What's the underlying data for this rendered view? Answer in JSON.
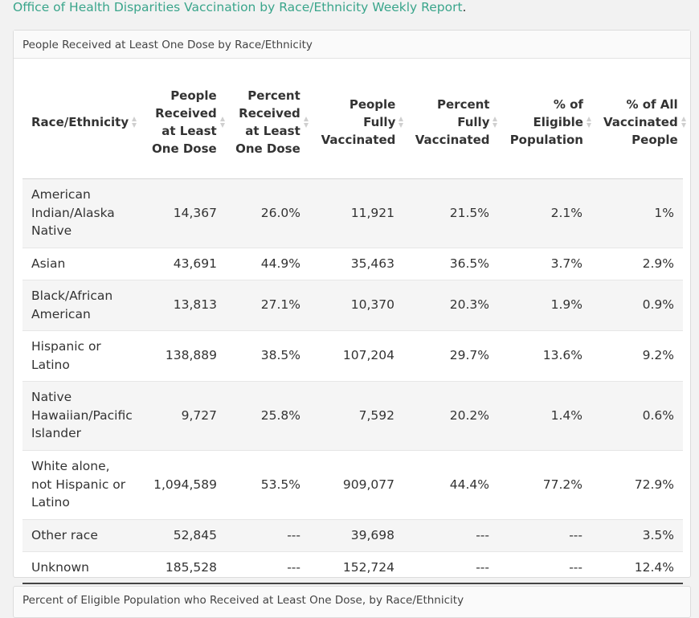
{
  "intro": {
    "link_text": "Office of Health Disparities Vaccination by Race/Ethnicity Weekly Report",
    "trailing": "."
  },
  "panel": {
    "title": "People Received at Least One Dose by Race/Ethnicity"
  },
  "table": {
    "columns": [
      {
        "label": "Race/Ethnicity",
        "sortable": true
      },
      {
        "label": "People Received at Least One Dose",
        "sortable": true
      },
      {
        "label": "Percent Received at Least One Dose",
        "sortable": true
      },
      {
        "label": "People Fully Vaccinated",
        "sortable": true
      },
      {
        "label": "Percent Fully Vaccinated",
        "sortable": true
      },
      {
        "label": "% of Eligible Population",
        "sortable": true
      },
      {
        "label": "% of All Vaccinated People",
        "sortable": true
      }
    ],
    "rows": [
      [
        "American Indian/Alaska Native",
        "14,367",
        "26.0%",
        "11,921",
        "21.5%",
        "2.1%",
        "1%"
      ],
      [
        "Asian",
        "43,691",
        "44.9%",
        "35,463",
        "36.5%",
        "3.7%",
        "2.9%"
      ],
      [
        "Black/African American",
        "13,813",
        "27.1%",
        "10,370",
        "20.3%",
        "1.9%",
        "0.9%"
      ],
      [
        "Hispanic or Latino",
        "138,889",
        "38.5%",
        "107,204",
        "29.7%",
        "13.6%",
        "9.2%"
      ],
      [
        "Native Hawaiian/Pacific Islander",
        "9,727",
        "25.8%",
        "7,592",
        "20.2%",
        "1.4%",
        "0.6%"
      ],
      [
        "White alone, not Hispanic or Latino",
        "1,094,589",
        "53.5%",
        "909,077",
        "44.4%",
        "77.2%",
        "72.9%"
      ],
      [
        "Other race",
        "52,845",
        "---",
        "39,698",
        "---",
        "---",
        "3.5%"
      ],
      [
        "Unknown",
        "185,528",
        "---",
        "152,724",
        "---",
        "---",
        "12.4%"
      ]
    ]
  },
  "next_panel": {
    "title": "Percent of Eligible Population who Received at Least One Dose, by Race/Ethnicity"
  },
  "colors": {
    "link": "#3aa58b",
    "stripe": "#f5f5f5"
  }
}
